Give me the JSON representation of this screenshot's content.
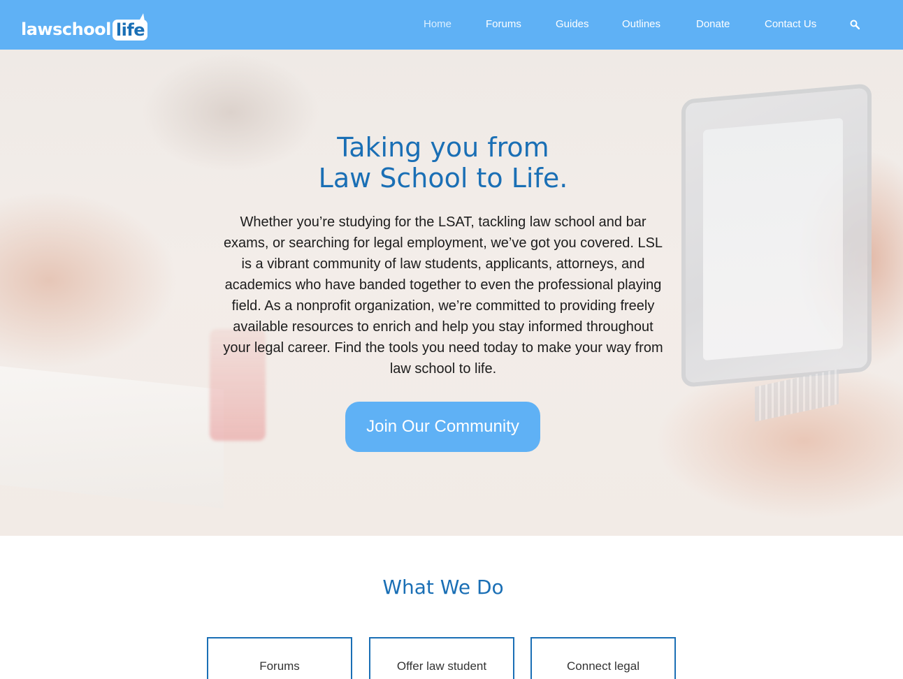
{
  "header": {
    "logo": {
      "part1": "lawschool",
      "part2": "life"
    },
    "nav": [
      {
        "label": "Home",
        "active": true
      },
      {
        "label": "Forums"
      },
      {
        "label": "Guides"
      },
      {
        "label": "Outlines"
      },
      {
        "label": "Donate"
      },
      {
        "label": "Contact Us"
      }
    ],
    "search_icon": "search-icon"
  },
  "hero": {
    "title_line1": "Taking you from",
    "title_line2": "Law School to Life.",
    "text": "Whether you’re studying for the LSAT, tackling law school and bar exams, or searching for legal employment, we’ve got you covered. LSL is a vibrant community of law students, applicants, attorneys, and academics who have banded together to even the professional playing field. As a nonprofit organization, we’re committed to providing freely available resources to enrich and help you stay informed throughout your legal career. Find the tools you need today to make your way from law school to life.",
    "cta": "Join Our Community"
  },
  "what_we_do": {
    "title": "What We Do",
    "cards": [
      "Forums",
      "Offer law student",
      "Connect legal"
    ]
  },
  "colors": {
    "brand_blue": "#5fb1f5",
    "heading_blue": "#1a6fb5"
  }
}
